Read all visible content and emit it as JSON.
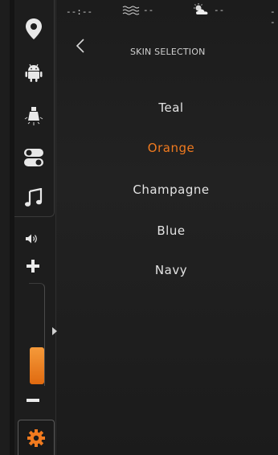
{
  "status_bar": {
    "clock": "--:--",
    "wind_value": "--",
    "weather_value": "--",
    "right_value": "--"
  },
  "sidebar": {
    "items": [
      {
        "icon": "map-pin-icon"
      },
      {
        "icon": "android-icon"
      },
      {
        "icon": "light-bulb-icon"
      },
      {
        "icon": "toggle-switch-icon"
      },
      {
        "icon": "music-note-icon"
      }
    ]
  },
  "header": {
    "title": "SKIN SELECTION"
  },
  "skins": {
    "items": [
      {
        "label": "Teal",
        "active": false
      },
      {
        "label": "Orange",
        "active": true
      },
      {
        "label": "Champagne",
        "active": false
      },
      {
        "label": "Blue",
        "active": false
      },
      {
        "label": "Navy",
        "active": false
      }
    ]
  },
  "volume": {
    "level": 0.36
  },
  "colors": {
    "accent": "#f07a1f",
    "text": "#e3e3e3",
    "background": "#1e1e1e"
  }
}
